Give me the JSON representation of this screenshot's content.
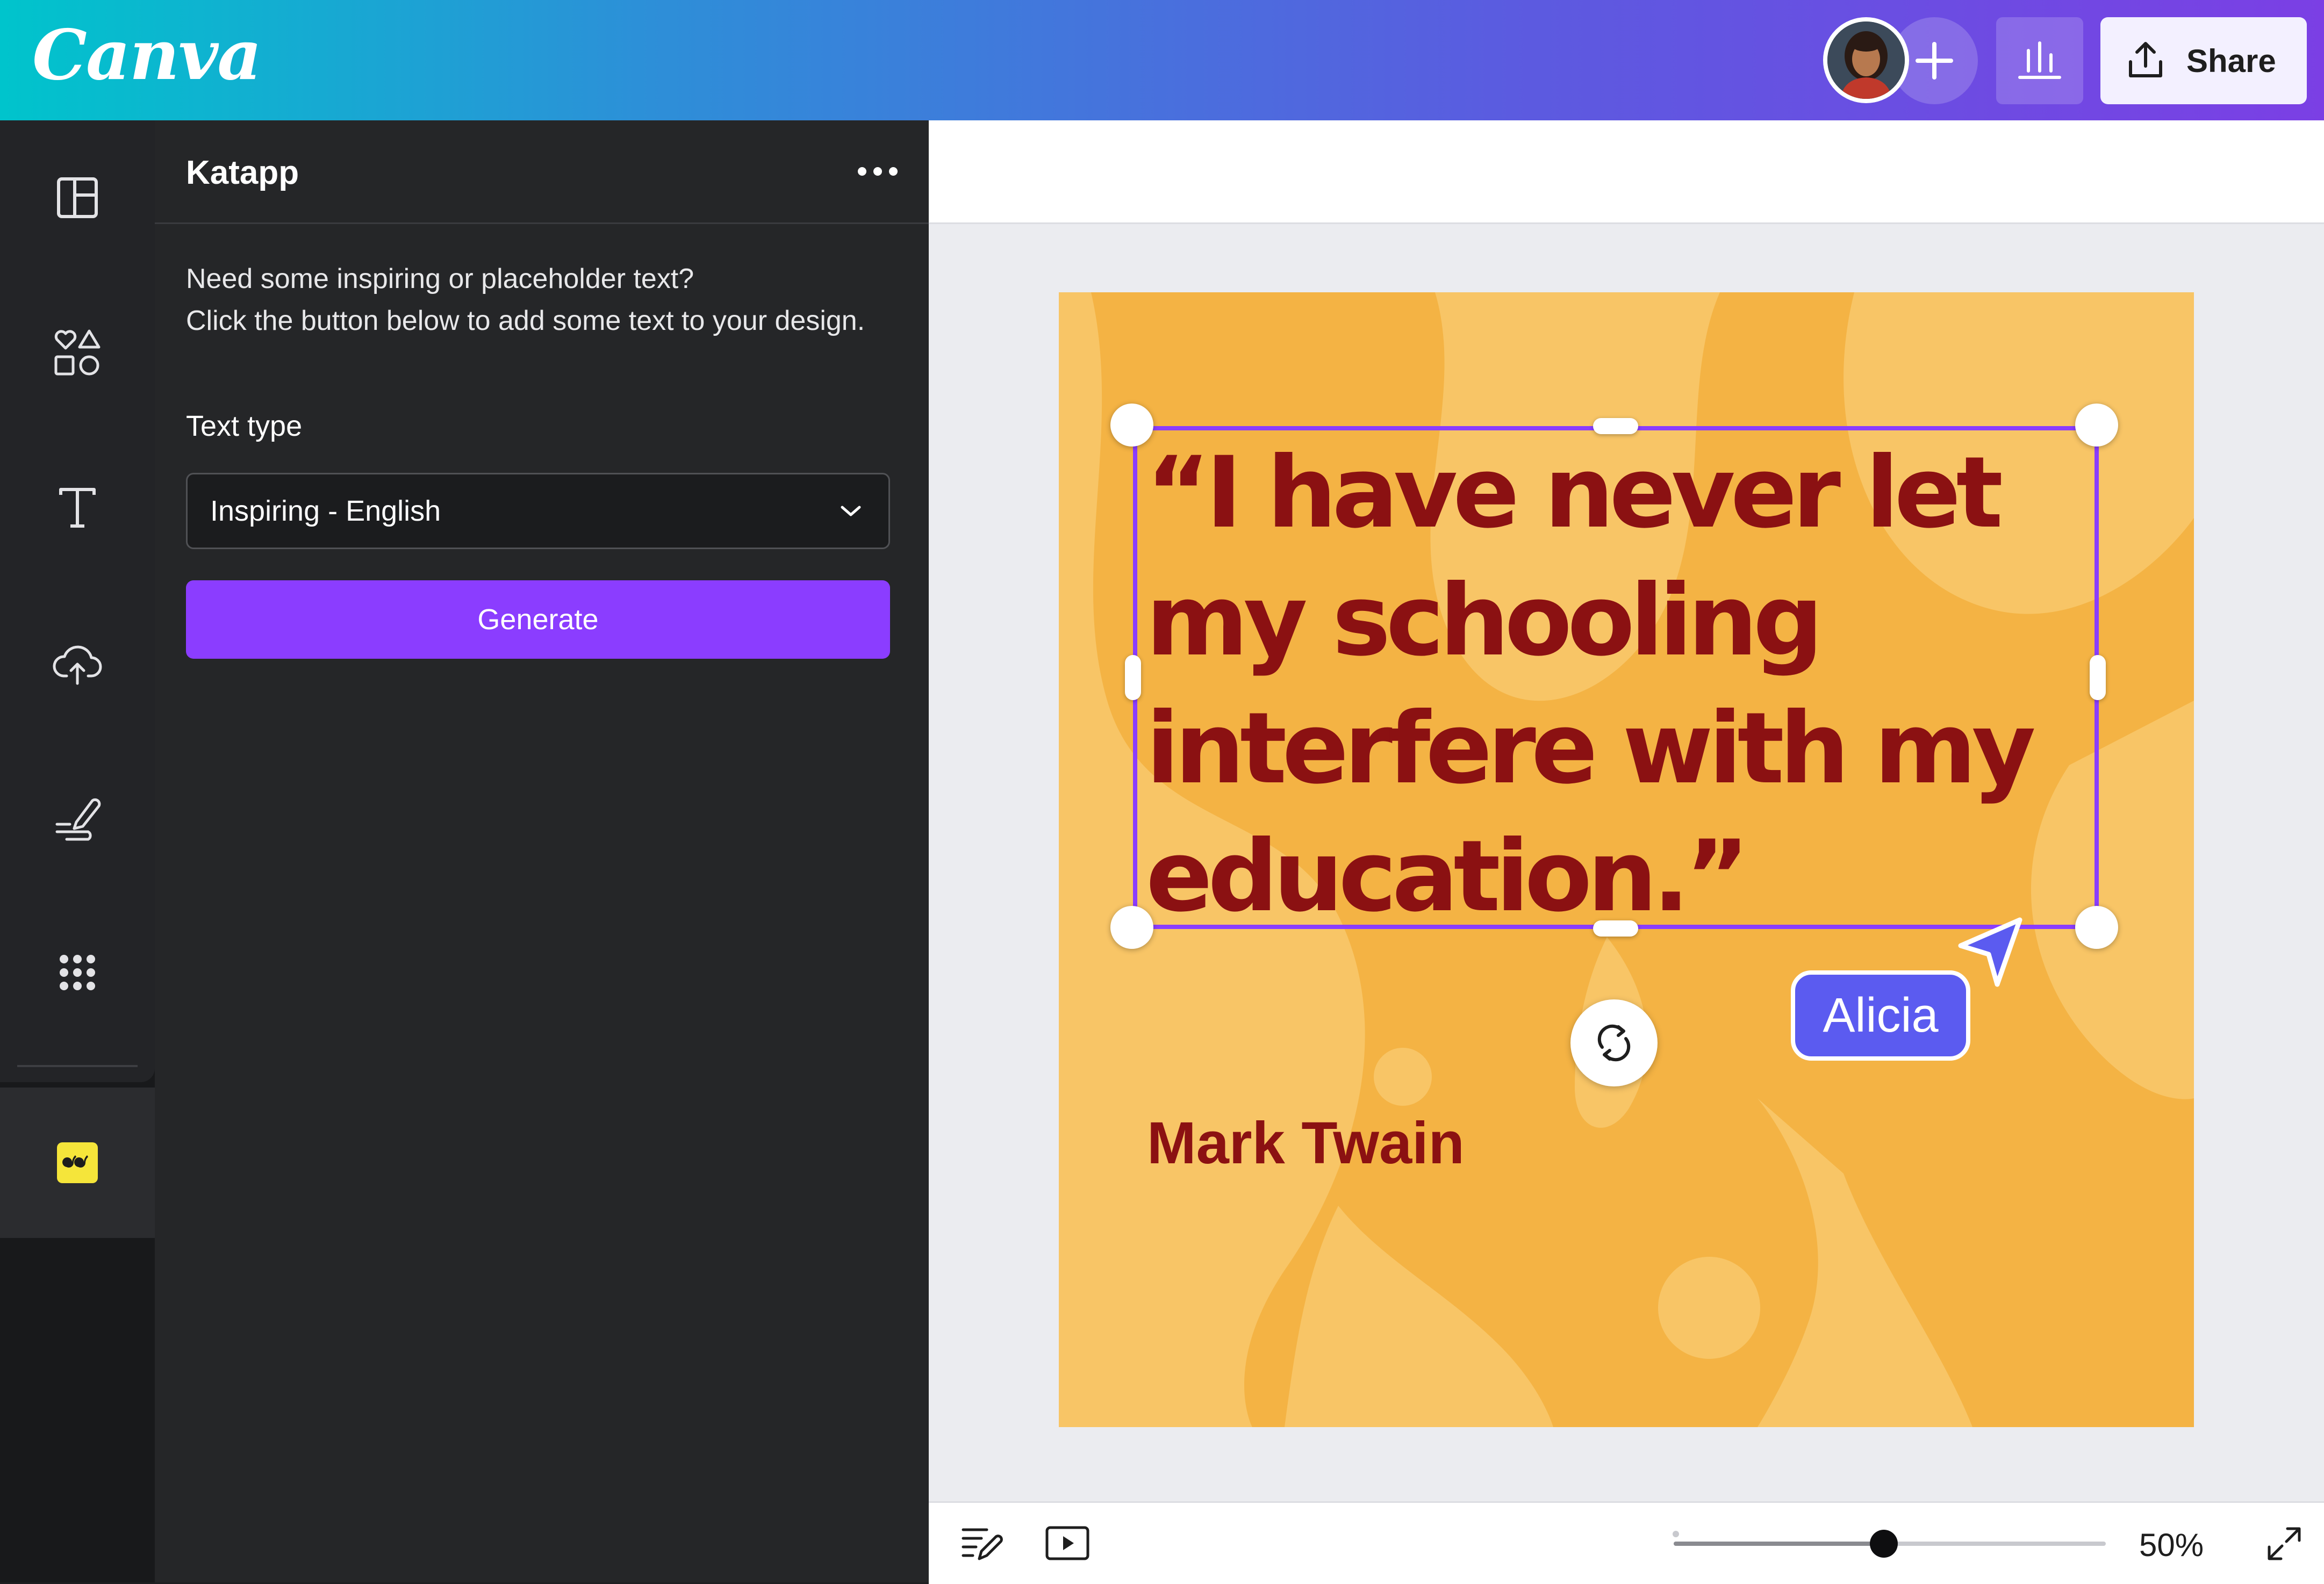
{
  "app": {
    "logo_text": "Canva",
    "share_label": "Share",
    "collaborator_avatar": "avatar-photo",
    "icons": [
      "plus-icon",
      "insights-icon",
      "share-upload-icon"
    ]
  },
  "rail": {
    "items": [
      "layout-icon",
      "elements-icon",
      "text-icon",
      "upload-icon",
      "draw-icon",
      "apps-icon"
    ],
    "active_item": "quote-app-icon"
  },
  "panel": {
    "title": "Katapp",
    "more_icon": "more-dots-icon",
    "description_line1": "Need some inspiring or placeholder text?",
    "description_line2": "Click the button below to add some text to your design.",
    "field_label": "Text type",
    "select_value": "Inspiring - English",
    "generate_label": "Generate"
  },
  "design": {
    "quote_text": "“I have never let my schooling interfere with my education.”",
    "author": "Mark Twain",
    "background_color": "#f4b344",
    "text_color": "#8b1112",
    "collaborator_cursor_name": "Alicia",
    "cursor_color": "#5b5bf0",
    "selection_color": "#8b3dff"
  },
  "footer": {
    "zoom_percent": 50,
    "zoom_label": "50%",
    "icons": [
      "notes-icon",
      "present-icon",
      "fullscreen-icon"
    ]
  }
}
